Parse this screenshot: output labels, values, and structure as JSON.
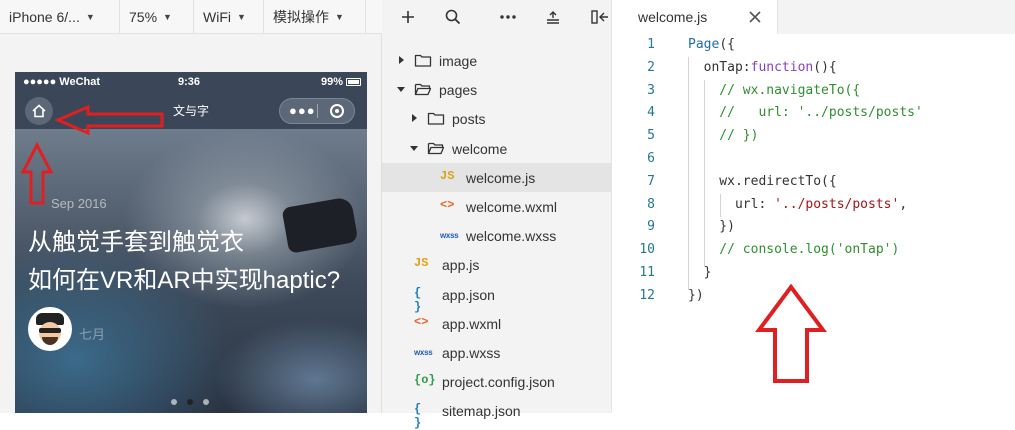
{
  "simulator": {
    "toolbar": {
      "device": "iPhone 6/...",
      "zoom": "75%",
      "network": "WiFi",
      "operation": "模拟操作"
    },
    "status_bar": {
      "carrier": "●●●●● WeChat",
      "time": "9:36",
      "battery": "99%"
    },
    "nav_bar": {
      "title": "文与字"
    },
    "banner": {
      "date": "Sep 2016",
      "headline_1": "从触觉手套到触觉衣",
      "headline_2": "如何在VR和AR中实现haptic?",
      "author": "七月"
    }
  },
  "explorer": {
    "tree": [
      {
        "name": "image",
        "type": "folder",
        "expanded": false
      },
      {
        "name": "pages",
        "type": "folder",
        "expanded": true
      },
      {
        "name": "posts",
        "type": "folder",
        "expanded": false
      },
      {
        "name": "welcome",
        "type": "folder",
        "expanded": true
      },
      {
        "name": "welcome.js",
        "type": "js",
        "selected": true,
        "icon_text": "JS"
      },
      {
        "name": "welcome.wxml",
        "type": "wxml",
        "icon_text": "<>"
      },
      {
        "name": "welcome.wxss",
        "type": "wxss",
        "icon_text": "wxss"
      },
      {
        "name": "app.js",
        "type": "js",
        "icon_text": "JS"
      },
      {
        "name": "app.json",
        "type": "json",
        "icon_text": "{ }"
      },
      {
        "name": "app.wxml",
        "type": "wxml",
        "icon_text": "<>"
      },
      {
        "name": "app.wxss",
        "type": "wxss",
        "icon_text": "wxss"
      },
      {
        "name": "project.config.json",
        "type": "config",
        "icon_text": "{o}"
      },
      {
        "name": "sitemap.json",
        "type": "json",
        "icon_text": "{ }"
      }
    ]
  },
  "editor": {
    "tab": {
      "label": "welcome.js"
    },
    "lines": [
      {
        "n": "1",
        "tokens": [
          [
            "fn",
            "Page"
          ],
          [
            "p",
            "({"
          ]
        ]
      },
      {
        "n": "2",
        "tokens": [
          [
            "p",
            "  onTap:"
          ],
          [
            "kw",
            "function"
          ],
          [
            "p",
            "(){"
          ]
        ]
      },
      {
        "n": "3",
        "tokens": [
          [
            "cm",
            "    // wx.navigateTo({"
          ]
        ]
      },
      {
        "n": "4",
        "tokens": [
          [
            "cm",
            "    //   url: '../posts/posts'"
          ]
        ]
      },
      {
        "n": "5",
        "tokens": [
          [
            "cm",
            "    // })"
          ]
        ]
      },
      {
        "n": "6",
        "tokens": []
      },
      {
        "n": "7",
        "tokens": [
          [
            "p",
            "    wx.redirectTo({"
          ]
        ]
      },
      {
        "n": "8",
        "tokens": [
          [
            "p",
            "      url: "
          ],
          [
            "str",
            "'../posts/posts'"
          ],
          [
            "p",
            ","
          ]
        ]
      },
      {
        "n": "9",
        "tokens": [
          [
            "p",
            "    })"
          ]
        ]
      },
      {
        "n": "10",
        "tokens": [
          [
            "cm",
            "    // console.log('onTap')"
          ]
        ]
      },
      {
        "n": "11",
        "tokens": [
          [
            "p",
            "  }"
          ]
        ]
      },
      {
        "n": "12",
        "tokens": [
          [
            "p",
            "})"
          ]
        ]
      }
    ]
  },
  "colors": {
    "annotation_red": "#e02020",
    "nav_bar": "#3b4658",
    "line_number": "#237893",
    "comment": "#2f8f2f",
    "keyword": "#8a3fbf",
    "string": "#a31515"
  }
}
